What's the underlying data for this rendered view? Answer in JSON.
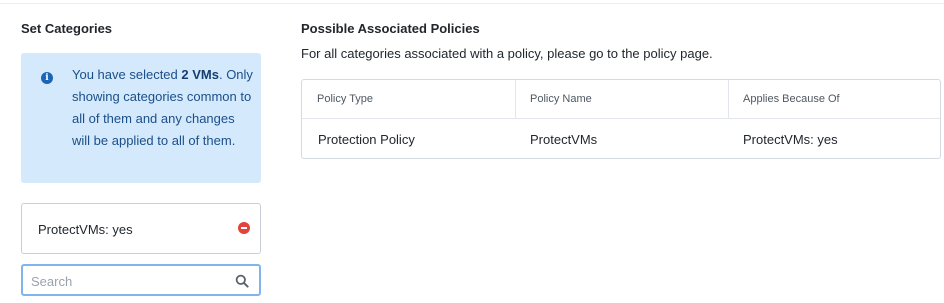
{
  "left_panel": {
    "title": "Set Categories",
    "info": {
      "prefix": "You have selected ",
      "highlight": "2 VMs",
      "suffix": ". Only showing categories common to all of them and any changes will be applied to all of them."
    },
    "categories": [
      {
        "label": "ProtectVMs: yes"
      }
    ],
    "search": {
      "placeholder": "Search",
      "value": ""
    }
  },
  "right_panel": {
    "title": "Possible Associated Policies",
    "subtitle": "For all categories associated with a policy, please go to the policy page.",
    "table": {
      "columns": [
        "Policy Type",
        "Policy Name",
        "Applies Because Of"
      ],
      "rows": [
        [
          "Protection Policy",
          "ProtectVMs",
          "ProtectVMs: yes"
        ]
      ]
    }
  },
  "icons": {
    "info": "info-icon",
    "remove": "remove-icon",
    "search": "search-icon"
  },
  "colors": {
    "info_bg": "#d4e9fb",
    "info_text": "#1b4f8a",
    "remove": "#e2443b",
    "search_focus": "#7fb5e8"
  }
}
